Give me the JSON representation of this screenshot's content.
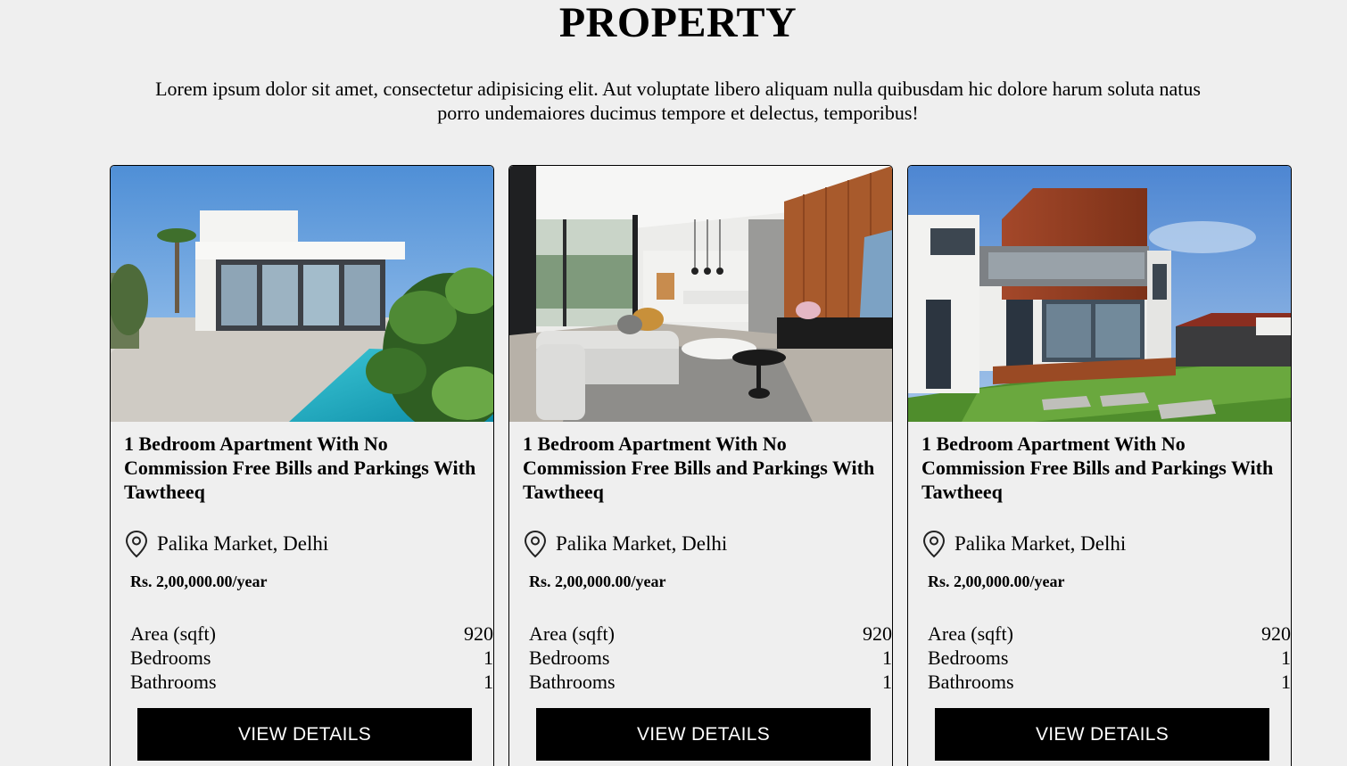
{
  "section": {
    "title": "PROPERTY",
    "intro": "Lorem ipsum dolor sit amet, consectetur adipisicing elit. Aut voluptate libero aliquam nulla quibusdam hic dolore harum soluta natus porro undemaiores ducimus tempore et delectus, temporibus!"
  },
  "listings": [
    {
      "photo": "modern-villa-with-pool",
      "title": "1 Bedroom Apartment With No Commission Free Bills and Parkings With Tawtheeq",
      "location_icon": "map-pin-icon",
      "location": "Palika Market, Delhi",
      "price": "Rs. 2,00,000.00/year",
      "specs": [
        {
          "label": "Area (sqft)",
          "value": "920"
        },
        {
          "label": "Bedrooms",
          "value": "1"
        },
        {
          "label": "Bathrooms",
          "value": "1"
        }
      ],
      "button": "VIEW DETAILS"
    },
    {
      "photo": "modern-living-room-interior",
      "title": "1 Bedroom Apartment With No Commission Free Bills and Parkings With Tawtheeq",
      "location_icon": "map-pin-icon",
      "location": "Palika Market, Delhi",
      "price": "Rs. 2,00,000.00/year",
      "specs": [
        {
          "label": "Area (sqft)",
          "value": "920"
        },
        {
          "label": "Bedrooms",
          "value": "1"
        },
        {
          "label": "Bathrooms",
          "value": "1"
        }
      ],
      "button": "VIEW DETAILS"
    },
    {
      "photo": "modern-two-storey-house-exterior",
      "title": "1 Bedroom Apartment With No Commission Free Bills and Parkings With Tawtheeq",
      "location_icon": "map-pin-icon",
      "location": "Palika Market, Delhi",
      "price": "Rs. 2,00,000.00/year",
      "specs": [
        {
          "label": "Area (sqft)",
          "value": "920"
        },
        {
          "label": "Bedrooms",
          "value": "1"
        },
        {
          "label": "Bathrooms",
          "value": "1"
        }
      ],
      "button": "VIEW DETAILS"
    }
  ],
  "colors": {
    "page_background": "#efefef",
    "button_background": "#000000",
    "button_text": "#ffffff"
  }
}
